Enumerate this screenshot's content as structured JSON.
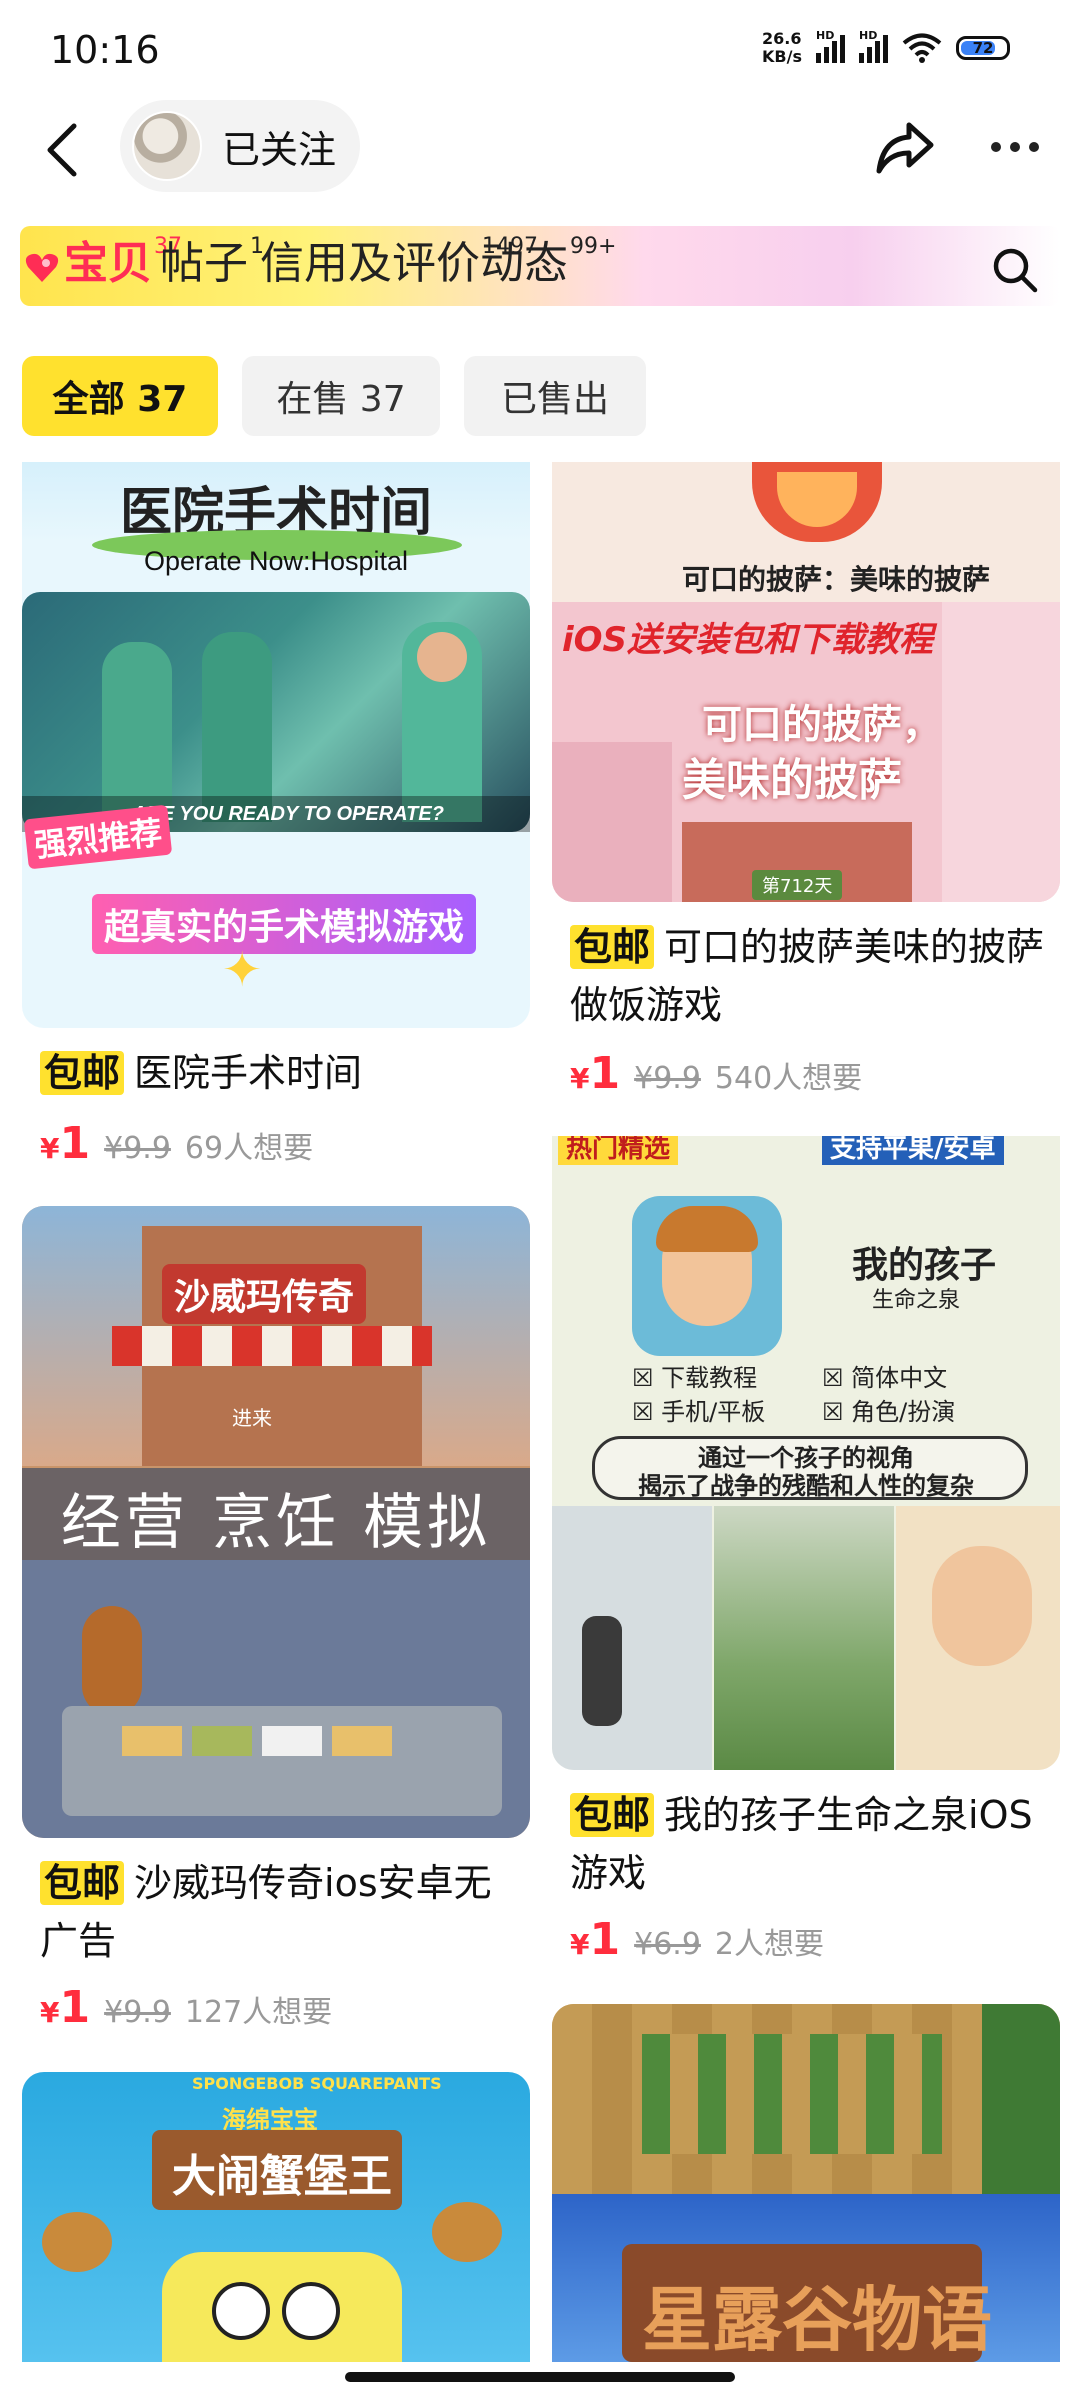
{
  "status": {
    "time": "10:16",
    "net_speed_value": "26.6",
    "net_speed_unit": "KB/s",
    "hd1": "HD",
    "hd2": "HD",
    "battery": "72"
  },
  "header": {
    "follow_label": "已关注"
  },
  "tabs": [
    {
      "label": "宝贝",
      "count": "37"
    },
    {
      "label": "帖子",
      "count": "1"
    },
    {
      "label": "信用及评价",
      "count": "1497"
    },
    {
      "label": "动态",
      "count": "99+"
    }
  ],
  "filters": {
    "all": "全部 37",
    "on_sale": "在售 37",
    "sold": "已售出"
  },
  "products": [
    {
      "tag": "包邮",
      "title": "医院手术时间",
      "yen": "¥",
      "price": "1",
      "original": "¥9.9",
      "wants": "69人想要",
      "image_text_1": "医院手术时间",
      "image_text_2": "Operate Now:Hospital",
      "image_text_3": "ARE YOU READY TO OPERATE?",
      "image_text_4": "强烈推荐",
      "image_text_5": "超真实的手术模拟游戏"
    },
    {
      "tag": "包邮",
      "title": "可口的披萨美味的披萨做饭游戏",
      "yen": "¥",
      "price": "1",
      "original": "¥9.9",
      "wants": "540人想要",
      "image_text_1": "可口的披萨：美味的披萨",
      "image_text_2": "iOS送安装包和下载教程",
      "image_text_3": "可口的披萨，",
      "image_text_4": "美味的披萨",
      "image_text_5": "第712天"
    },
    {
      "tag": "包邮",
      "title": "沙威玛传奇ios安卓无广告",
      "yen": "¥",
      "price": "1",
      "original": "¥9.9",
      "wants": "127人想要",
      "image_text_1": "沙威玛传奇",
      "image_text_2": "经营 烹饪 模拟",
      "image_text_3": "进来"
    },
    {
      "tag": "包邮",
      "title": "我的孩子生命之泉iOS游戏",
      "yen": "¥",
      "price": "1",
      "original": "¥6.9",
      "wants": "2人想要",
      "image_text_1": "热门精选",
      "image_text_2": "支持平果/安卓",
      "image_text_3": "我的孩子",
      "image_text_4": "生命之泉",
      "image_text_5": "☒ 下载教程",
      "image_text_6": "☒ 简体中文",
      "image_text_7": "☒ 手机/平板",
      "image_text_8": "☒ 角色/扮演",
      "image_text_9": "通过一个孩子的视角",
      "image_text_10": "揭示了战争的残酷和人性的复杂"
    },
    {
      "image_text_1": "SPONGEBOB SQUAREPANTS",
      "image_text_2": "海绵宝宝",
      "image_text_3": "大闹蟹堡王"
    },
    {
      "image_text_1": "星露谷物语"
    }
  ]
}
